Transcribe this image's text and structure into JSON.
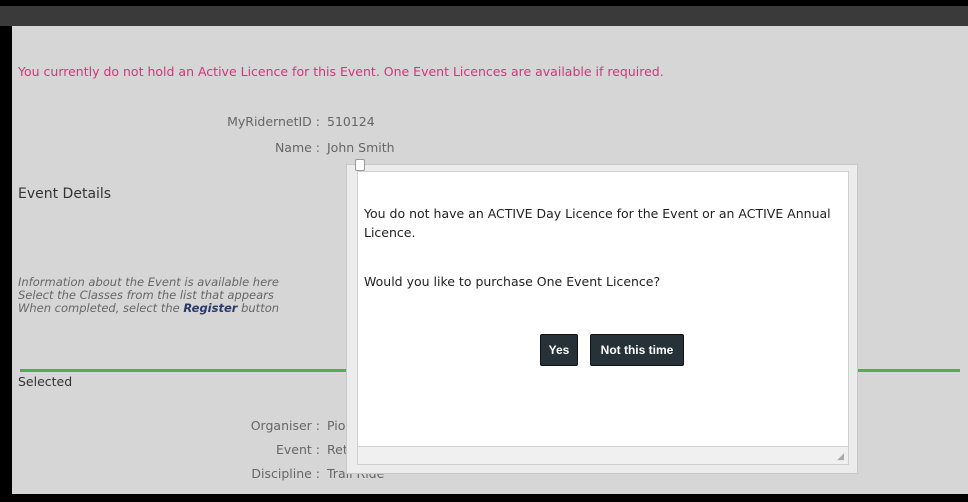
{
  "alert": {
    "text": "You currently do not hold an Active Licence for this Event. One Event Licences are available if required."
  },
  "rider": {
    "id_label": "MyRidernetID :",
    "id_value": "510124",
    "name_label": "Name :",
    "name_value": "John Smith"
  },
  "event_details": {
    "title": "Event Details",
    "info_line1": "Information about the Event is available here",
    "info_line2": "Select the Classes from the list that appears",
    "info_line3_prefix": "When completed, select the ",
    "info_line3_bold": "Register",
    "info_line3_suffix": " button"
  },
  "selected": {
    "title": "Selected",
    "organiser_label": "Organiser :",
    "organiser_value": "Pio",
    "event_label": "Event :",
    "event_value": "Ret",
    "discipline_label": "Discipline :",
    "discipline_value": "Trail Ride"
  },
  "dialog": {
    "message1": "You do not have an ACTIVE Day Licence for the Event or an ACTIVE Annual Licence.",
    "message2": "Would you like to purchase One Event Licence?",
    "yes_label": "Yes",
    "no_label": "Not this time"
  },
  "colors": {
    "alert": "#d6337c",
    "accent_rule": "#4caf50",
    "button_bg": "#263238"
  }
}
